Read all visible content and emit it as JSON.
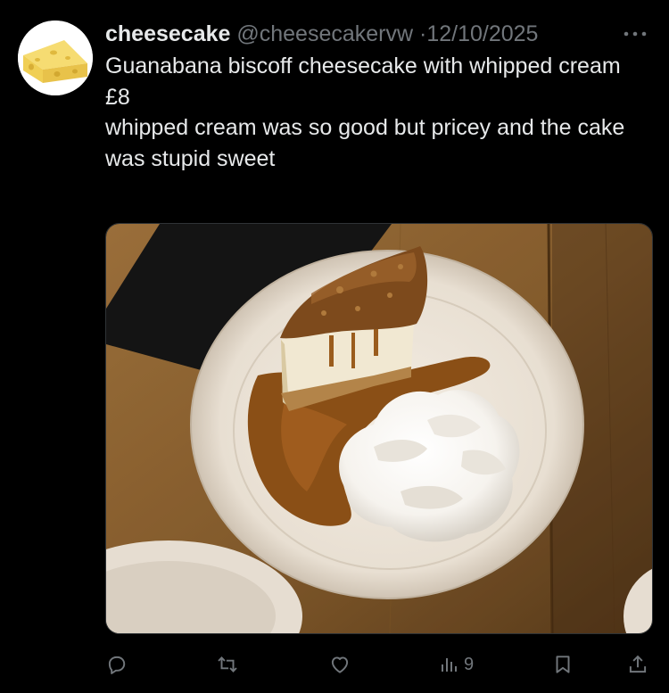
{
  "tweet": {
    "author_name": "cheesecake",
    "author_handle": "@cheesecakervw",
    "separator": "·",
    "date": "12/10/2025",
    "text_lines": [
      "Guanabana biscoff cheesecake with whipped cream",
      "£8",
      "whipped cream was so good but pricey and the cake was stupid sweet"
    ]
  },
  "avatar_icon": "cheese-wedge-icon",
  "media": {
    "subject": "photo"
  },
  "actions": {
    "reply_icon": "reply-icon",
    "retweet_icon": "retweet-icon",
    "like_icon": "heart-icon",
    "views_icon": "views-icon",
    "views_count": "9",
    "bookmark_icon": "bookmark-icon",
    "share_icon": "share-icon"
  },
  "colors": {
    "background": "#000000",
    "text_primary": "#e7e9ea",
    "text_secondary": "#71767b"
  }
}
